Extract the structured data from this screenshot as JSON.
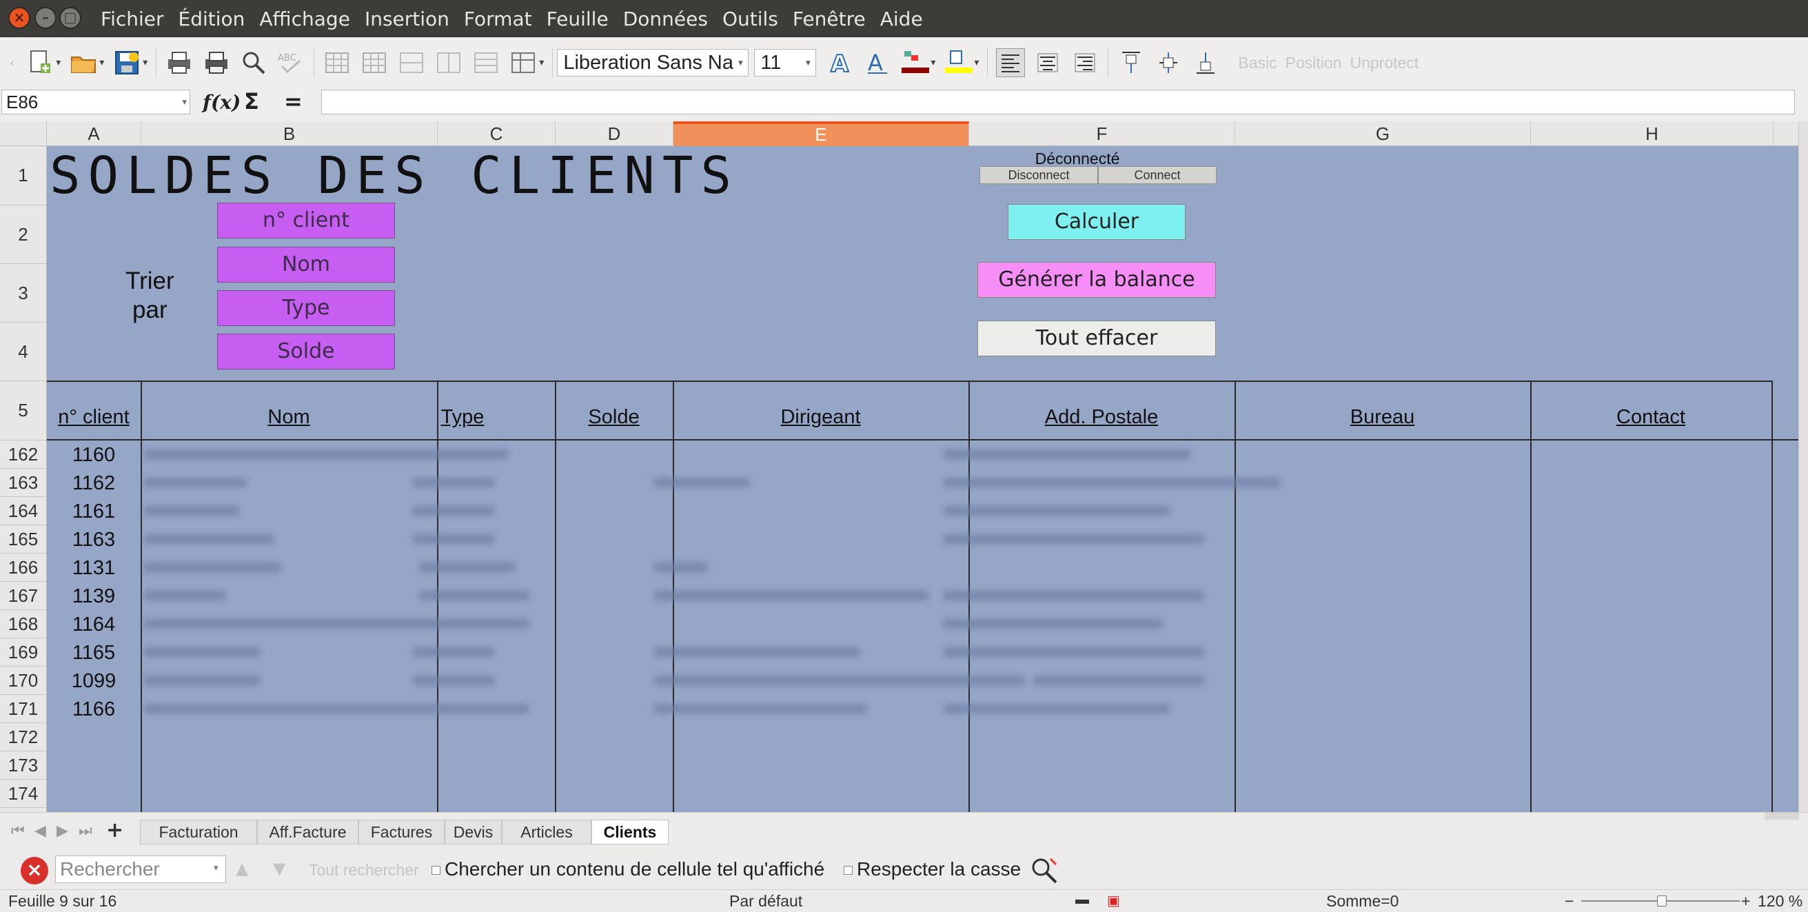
{
  "window": {
    "menu": [
      "Fichier",
      "Édition",
      "Affichage",
      "Insertion",
      "Format",
      "Feuille",
      "Données",
      "Outils",
      "Fenêtre",
      "Aide"
    ]
  },
  "toolbar": {
    "font_name": "Liberation Sans Narr",
    "font_size": "11",
    "extra_labels": [
      "Basic",
      "Position",
      "Unprotect"
    ]
  },
  "formula": {
    "cell_ref": "E86",
    "content": ""
  },
  "columns": [
    "A",
    "B",
    "C",
    "D",
    "E",
    "F",
    "G",
    "H"
  ],
  "selected_column": "E",
  "rows_top": [
    "1",
    "2",
    "3",
    "4",
    "5"
  ],
  "sheet": {
    "title": "SOLDES DES CLIENTS",
    "sort_label": [
      "Trier",
      "par"
    ],
    "sort_buttons": [
      "n° client",
      "Nom",
      "Type",
      "Solde"
    ],
    "status": "Déconnecté",
    "disconnect": "Disconnect",
    "connect": "Connect",
    "calculer": "Calculer",
    "generer": "Générer la balance",
    "effacer": "Tout effacer",
    "headers": [
      "n° client",
      "Nom",
      "Type",
      "Solde",
      "Dirigeant",
      "Add. Postale",
      "Bureau",
      "Contact"
    ]
  },
  "data_rows": [
    {
      "row": "162",
      "id": "1160"
    },
    {
      "row": "163",
      "id": "1162"
    },
    {
      "row": "164",
      "id": "1161"
    },
    {
      "row": "165",
      "id": "1163"
    },
    {
      "row": "166",
      "id": "1131"
    },
    {
      "row": "167",
      "id": "1139"
    },
    {
      "row": "168",
      "id": "1164"
    },
    {
      "row": "169",
      "id": "1165"
    },
    {
      "row": "170",
      "id": "1099"
    },
    {
      "row": "171",
      "id": "1166"
    },
    {
      "row": "172",
      "id": ""
    },
    {
      "row": "173",
      "id": ""
    },
    {
      "row": "174",
      "id": ""
    }
  ],
  "tabs": [
    "Facturation",
    "Aff.Facture",
    "Factures",
    "Devis",
    "Articles",
    "Clients"
  ],
  "active_tab": "Clients",
  "findbar": {
    "placeholder": "Rechercher",
    "find_all": "Tout rechercher",
    "option1": "Chercher un contenu de cellule tel qu'affiché",
    "option2": "Respecter la casse"
  },
  "status": {
    "sheet": "Feuille 9 sur 16",
    "style": "Par défaut",
    "sum": "Somme=0",
    "zoom": "120 %"
  },
  "colors": {
    "sheet_bg": "#96a6c6",
    "sort_btn": "#c75ef2",
    "calculer": "#7ff0f0",
    "generer": "#f78ef7",
    "effacer": "#ececea",
    "selected_col": "#e95420"
  }
}
